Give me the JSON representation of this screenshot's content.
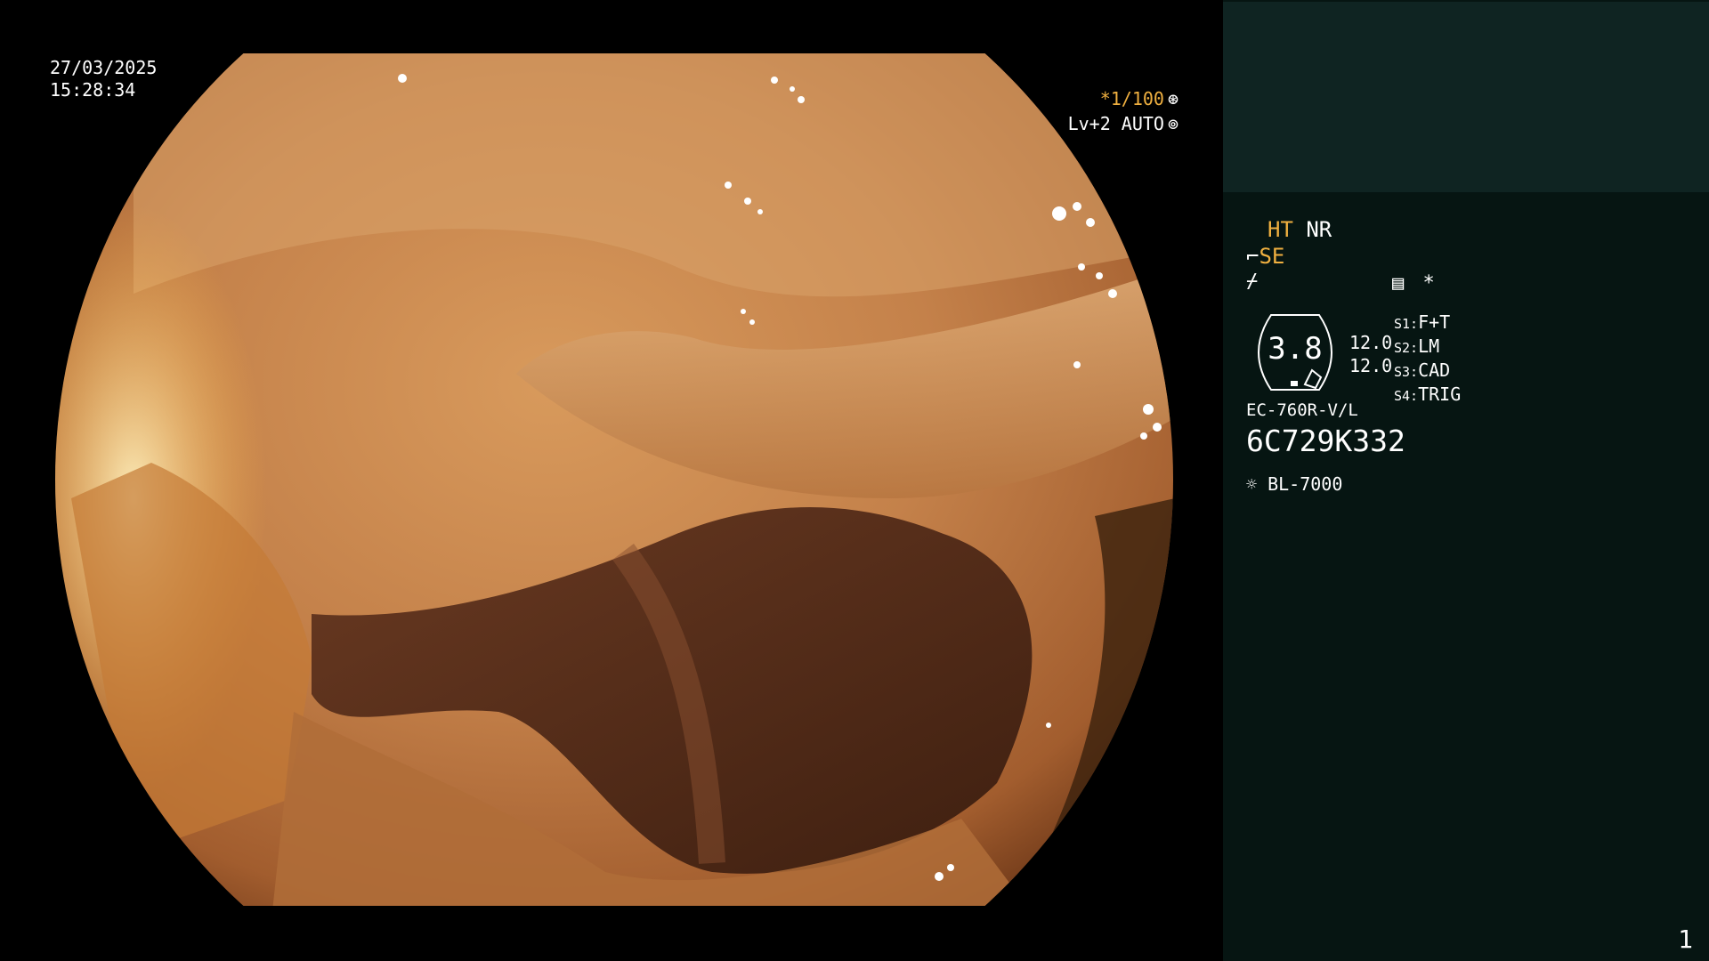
{
  "overlay": {
    "date": "27/03/2025",
    "time": "15:28:34",
    "shutter": "*1/100",
    "shutter_icon": "aperture-icon",
    "level": "Lv+2 AUTO",
    "level_icon": "iris-icon"
  },
  "panel": {
    "ht": "HT",
    "nr": "NR",
    "se": "SE",
    "structure_icon": "structure-enhance-icon",
    "freeze_icon": "freeze-icon",
    "menu_icon": "menu-list-icon",
    "asterisk": "*",
    "gauge_value": "3.8",
    "val1": "12.0",
    "val2": "12.0",
    "slots": [
      {
        "key": "S1:",
        "value": "F+T"
      },
      {
        "key": "S2:",
        "value": "LM"
      },
      {
        "key": "S3:",
        "value": "CAD"
      },
      {
        "key": "S4:",
        "value": "TRIG"
      }
    ],
    "scope_model": "EC-760R-V/L",
    "scope_serial": "6C729K332",
    "light_source": "BL-7000",
    "light_icon": "sun-icon"
  },
  "page_number": "1",
  "colors": {
    "accent_yellow": "#f0b040",
    "panel_bg": "#061512",
    "panel_top_bg": "#0f2422"
  }
}
